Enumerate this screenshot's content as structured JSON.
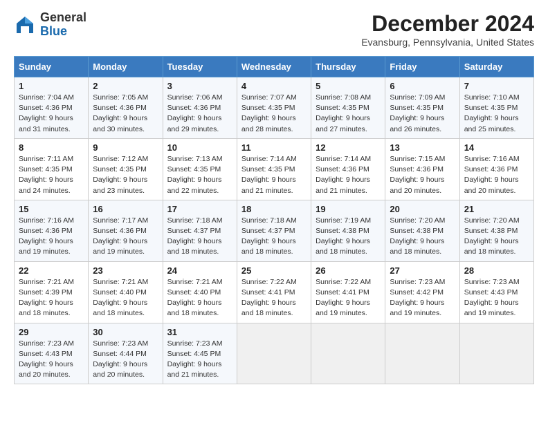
{
  "header": {
    "logo_line1": "General",
    "logo_line2": "Blue",
    "month": "December 2024",
    "location": "Evansburg, Pennsylvania, United States"
  },
  "weekdays": [
    "Sunday",
    "Monday",
    "Tuesday",
    "Wednesday",
    "Thursday",
    "Friday",
    "Saturday"
  ],
  "weeks": [
    [
      {
        "day": "1",
        "info": "Sunrise: 7:04 AM\nSunset: 4:36 PM\nDaylight: 9 hours\nand 31 minutes."
      },
      {
        "day": "2",
        "info": "Sunrise: 7:05 AM\nSunset: 4:36 PM\nDaylight: 9 hours\nand 30 minutes."
      },
      {
        "day": "3",
        "info": "Sunrise: 7:06 AM\nSunset: 4:36 PM\nDaylight: 9 hours\nand 29 minutes."
      },
      {
        "day": "4",
        "info": "Sunrise: 7:07 AM\nSunset: 4:35 PM\nDaylight: 9 hours\nand 28 minutes."
      },
      {
        "day": "5",
        "info": "Sunrise: 7:08 AM\nSunset: 4:35 PM\nDaylight: 9 hours\nand 27 minutes."
      },
      {
        "day": "6",
        "info": "Sunrise: 7:09 AM\nSunset: 4:35 PM\nDaylight: 9 hours\nand 26 minutes."
      },
      {
        "day": "7",
        "info": "Sunrise: 7:10 AM\nSunset: 4:35 PM\nDaylight: 9 hours\nand 25 minutes."
      }
    ],
    [
      {
        "day": "8",
        "info": "Sunrise: 7:11 AM\nSunset: 4:35 PM\nDaylight: 9 hours\nand 24 minutes."
      },
      {
        "day": "9",
        "info": "Sunrise: 7:12 AM\nSunset: 4:35 PM\nDaylight: 9 hours\nand 23 minutes."
      },
      {
        "day": "10",
        "info": "Sunrise: 7:13 AM\nSunset: 4:35 PM\nDaylight: 9 hours\nand 22 minutes."
      },
      {
        "day": "11",
        "info": "Sunrise: 7:14 AM\nSunset: 4:35 PM\nDaylight: 9 hours\nand 21 minutes."
      },
      {
        "day": "12",
        "info": "Sunrise: 7:14 AM\nSunset: 4:36 PM\nDaylight: 9 hours\nand 21 minutes."
      },
      {
        "day": "13",
        "info": "Sunrise: 7:15 AM\nSunset: 4:36 PM\nDaylight: 9 hours\nand 20 minutes."
      },
      {
        "day": "14",
        "info": "Sunrise: 7:16 AM\nSunset: 4:36 PM\nDaylight: 9 hours\nand 20 minutes."
      }
    ],
    [
      {
        "day": "15",
        "info": "Sunrise: 7:16 AM\nSunset: 4:36 PM\nDaylight: 9 hours\nand 19 minutes."
      },
      {
        "day": "16",
        "info": "Sunrise: 7:17 AM\nSunset: 4:36 PM\nDaylight: 9 hours\nand 19 minutes."
      },
      {
        "day": "17",
        "info": "Sunrise: 7:18 AM\nSunset: 4:37 PM\nDaylight: 9 hours\nand 18 minutes."
      },
      {
        "day": "18",
        "info": "Sunrise: 7:18 AM\nSunset: 4:37 PM\nDaylight: 9 hours\nand 18 minutes."
      },
      {
        "day": "19",
        "info": "Sunrise: 7:19 AM\nSunset: 4:38 PM\nDaylight: 9 hours\nand 18 minutes."
      },
      {
        "day": "20",
        "info": "Sunrise: 7:20 AM\nSunset: 4:38 PM\nDaylight: 9 hours\nand 18 minutes."
      },
      {
        "day": "21",
        "info": "Sunrise: 7:20 AM\nSunset: 4:38 PM\nDaylight: 9 hours\nand 18 minutes."
      }
    ],
    [
      {
        "day": "22",
        "info": "Sunrise: 7:21 AM\nSunset: 4:39 PM\nDaylight: 9 hours\nand 18 minutes."
      },
      {
        "day": "23",
        "info": "Sunrise: 7:21 AM\nSunset: 4:40 PM\nDaylight: 9 hours\nand 18 minutes."
      },
      {
        "day": "24",
        "info": "Sunrise: 7:21 AM\nSunset: 4:40 PM\nDaylight: 9 hours\nand 18 minutes."
      },
      {
        "day": "25",
        "info": "Sunrise: 7:22 AM\nSunset: 4:41 PM\nDaylight: 9 hours\nand 18 minutes."
      },
      {
        "day": "26",
        "info": "Sunrise: 7:22 AM\nSunset: 4:41 PM\nDaylight: 9 hours\nand 19 minutes."
      },
      {
        "day": "27",
        "info": "Sunrise: 7:23 AM\nSunset: 4:42 PM\nDaylight: 9 hours\nand 19 minutes."
      },
      {
        "day": "28",
        "info": "Sunrise: 7:23 AM\nSunset: 4:43 PM\nDaylight: 9 hours\nand 19 minutes."
      }
    ],
    [
      {
        "day": "29",
        "info": "Sunrise: 7:23 AM\nSunset: 4:43 PM\nDaylight: 9 hours\nand 20 minutes."
      },
      {
        "day": "30",
        "info": "Sunrise: 7:23 AM\nSunset: 4:44 PM\nDaylight: 9 hours\nand 20 minutes."
      },
      {
        "day": "31",
        "info": "Sunrise: 7:23 AM\nSunset: 4:45 PM\nDaylight: 9 hours\nand 21 minutes."
      },
      null,
      null,
      null,
      null
    ]
  ]
}
